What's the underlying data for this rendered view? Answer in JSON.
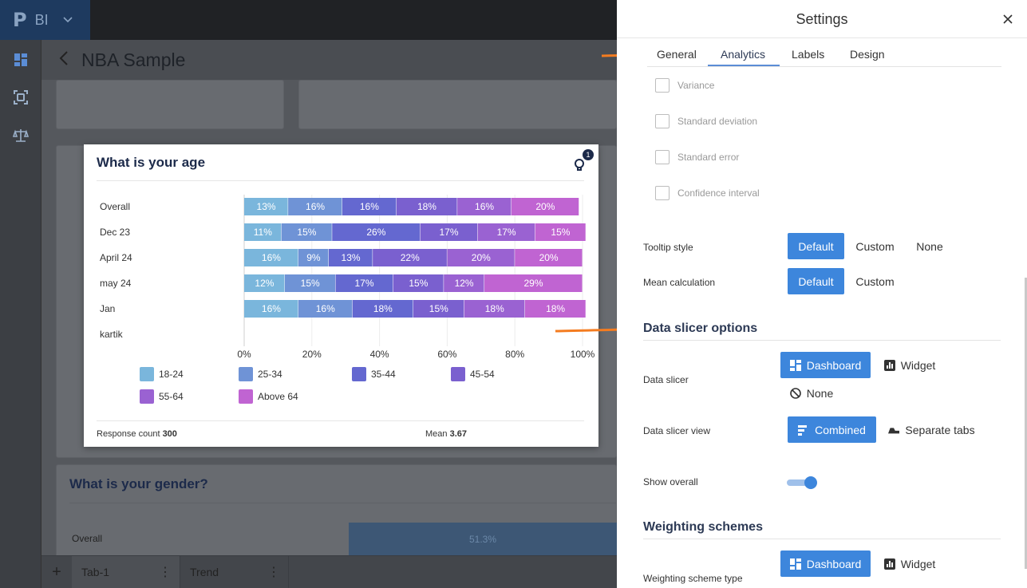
{
  "app": {
    "brand_logo": "P",
    "brand_name": "BI",
    "page_title": "NBA Sample"
  },
  "rail": {
    "icons": [
      "dashboard-icon",
      "scan-icon",
      "scale-icon"
    ]
  },
  "background": {
    "gender_title": "What is your gender?",
    "gender_row_label": "Overall",
    "gender_value": "51.3%"
  },
  "tabs": [
    {
      "label": "Tab-1"
    },
    {
      "label": "Trend"
    }
  ],
  "widget": {
    "title": "What is your age",
    "badge": "1",
    "response_label": "Response count",
    "response_value": "300",
    "mean_label": "Mean",
    "mean_value": "3.67"
  },
  "chart_data": {
    "type": "bar",
    "orientation": "horizontal-stacked-100",
    "categories": [
      "Overall",
      "Dec 23",
      "April 24",
      "may 24",
      "Jan",
      "kartik"
    ],
    "series": [
      {
        "name": "18-24",
        "color": "#7ab6dc",
        "values": [
          13,
          11,
          16,
          12,
          16,
          null
        ]
      },
      {
        "name": "25-34",
        "color": "#6f93d6",
        "values": [
          16,
          15,
          9,
          15,
          16,
          null
        ]
      },
      {
        "name": "35-44",
        "color": "#6468d0",
        "values": [
          16,
          26,
          13,
          17,
          18,
          null
        ]
      },
      {
        "name": "45-54",
        "color": "#7a60cf",
        "values": [
          18,
          17,
          22,
          15,
          15,
          null
        ]
      },
      {
        "name": "55-64",
        "color": "#9a62d2",
        "values": [
          16,
          17,
          20,
          12,
          18,
          null
        ]
      },
      {
        "name": "Above 64",
        "color": "#c064d2",
        "values": [
          20,
          15,
          20,
          29,
          18,
          null
        ]
      }
    ],
    "xticks": [
      "0%",
      "20%",
      "40%",
      "60%",
      "80%",
      "100%"
    ],
    "xlim": [
      0,
      100
    ],
    "grid": true,
    "legend_position": "bottom"
  },
  "settings": {
    "title": "Settings",
    "tabs": [
      "General",
      "Analytics",
      "Labels",
      "Design"
    ],
    "active_tab": "Analytics",
    "checks": [
      "Variance",
      "Standard deviation",
      "Standard error",
      "Confidence interval"
    ],
    "tooltip_style": {
      "label": "Tooltip style",
      "options": [
        "Default",
        "Custom",
        "None"
      ]
    },
    "mean_calc": {
      "label": "Mean calculation",
      "options": [
        "Default",
        "Custom"
      ]
    },
    "slicer_section": "Data slicer options",
    "data_slicer": {
      "label": "Data slicer",
      "options": [
        "Dashboard",
        "Widget",
        "None"
      ]
    },
    "slicer_view": {
      "label": "Data slicer view",
      "options": [
        "Combined",
        "Separate tabs"
      ]
    },
    "show_overall": {
      "label": "Show overall",
      "on": true
    },
    "weighting_section": "Weighting schemes",
    "weighting_type": {
      "label": "Weighting scheme type",
      "options": [
        "Dashboard",
        "Widget"
      ]
    }
  },
  "colors": {
    "accent": "#3d86dc",
    "annotation_arrow": "#f47c20",
    "title_navy": "#1c2a4a"
  }
}
